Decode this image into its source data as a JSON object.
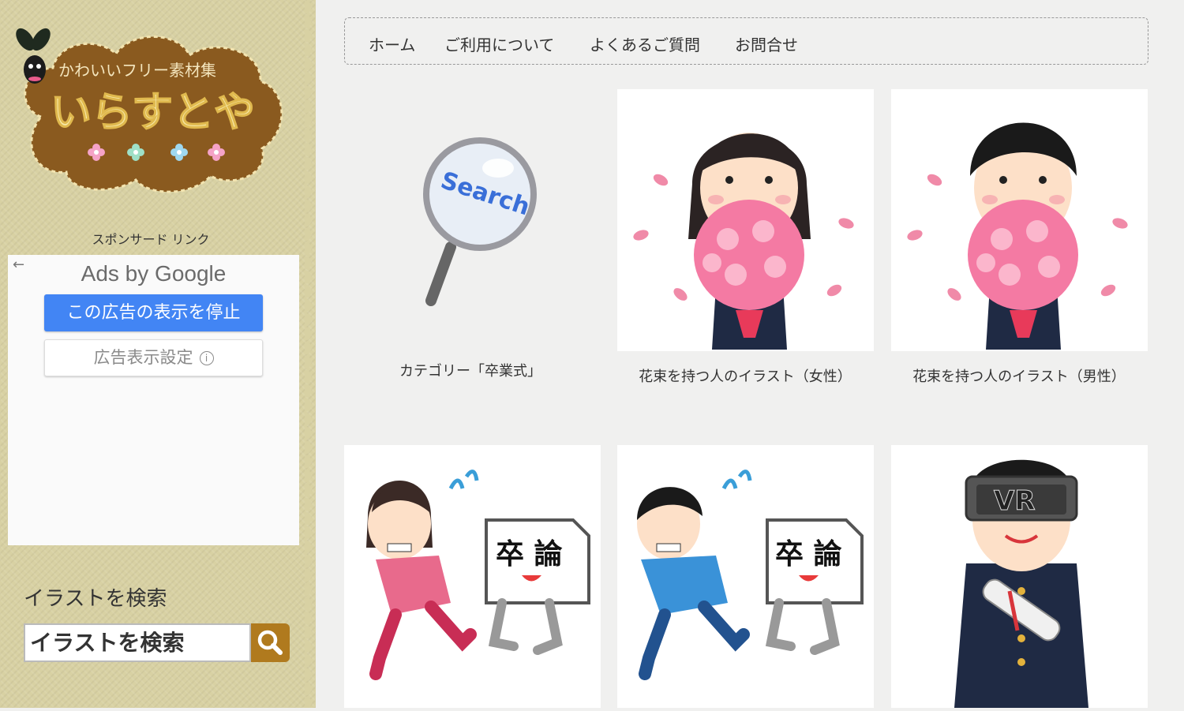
{
  "site": {
    "tagline": "かわいいフリー素材集",
    "name": "いらすとや"
  },
  "sidebar": {
    "sponsor_label": "スポンサード リンク",
    "ad": {
      "ads_by": "Ads by",
      "google": "Google",
      "stop_button": "この広告の表示を停止",
      "settings_button": "広告表示設定",
      "info_glyph": "i",
      "back_glyph": "←"
    },
    "search": {
      "title": "イラストを検索",
      "placeholder": "イラストを検索"
    }
  },
  "nav": {
    "items": [
      "ホーム",
      "ご利用について",
      "よくあるご質問",
      "お問合せ"
    ]
  },
  "cards": [
    {
      "caption": "カテゴリー「卒業式」",
      "search_text": "Search"
    },
    {
      "caption": "花束を持つ人のイラスト（女性）"
    },
    {
      "caption": "花束を持つ人のイラスト（男性）"
    },
    {
      "paper_text": "卒 論"
    },
    {
      "paper_text": "卒 論"
    },
    {
      "headset_text": "VR"
    }
  ],
  "colors": {
    "sidebar_bg": "#d8d1a3",
    "logo_brown": "#8a5a1f",
    "ad_blue": "#4285f4",
    "search_button": "#b07a1e"
  }
}
